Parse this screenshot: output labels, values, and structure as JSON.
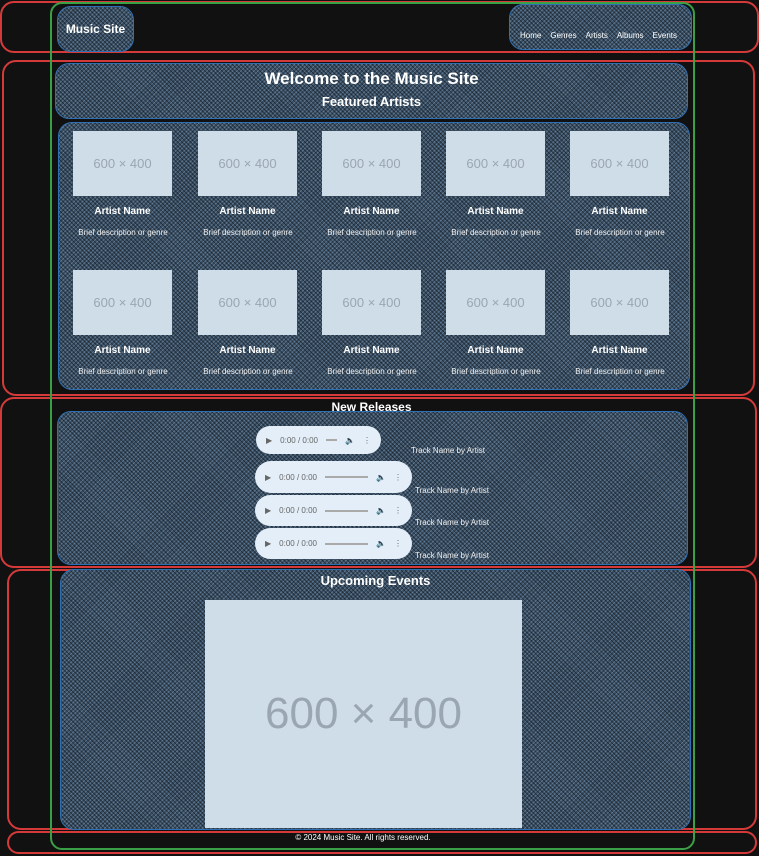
{
  "header": {
    "logo": "Music Site",
    "nav": [
      "Home",
      "Genres",
      "Artists",
      "Albums",
      "Events"
    ]
  },
  "hero": {
    "title": "Welcome to the Music Site",
    "featured_title": "Featured Artists"
  },
  "artists": [
    {
      "image": "600 × 400",
      "name": "Artist Name",
      "desc": "Brief description or genre"
    },
    {
      "image": "600 × 400",
      "name": "Artist Name",
      "desc": "Brief description or genre"
    },
    {
      "image": "600 × 400",
      "name": "Artist Name",
      "desc": "Brief description or genre"
    },
    {
      "image": "600 × 400",
      "name": "Artist Name",
      "desc": "Brief description or genre"
    },
    {
      "image": "600 × 400",
      "name": "Artist Name",
      "desc": "Brief description or genre"
    },
    {
      "image": "600 × 400",
      "name": "Artist Name",
      "desc": "Brief description or genre"
    },
    {
      "image": "600 × 400",
      "name": "Artist Name",
      "desc": "Brief description or genre"
    },
    {
      "image": "600 × 400",
      "name": "Artist Name",
      "desc": "Brief description or genre"
    },
    {
      "image": "600 × 400",
      "name": "Artist Name",
      "desc": "Brief description or genre"
    },
    {
      "image": "600 × 400",
      "name": "Artist Name",
      "desc": "Brief description or genre"
    }
  ],
  "releases": {
    "title": "New Releases",
    "tracks": [
      {
        "time": "0:00 / 0:00",
        "label": "Track Name by Artist"
      },
      {
        "time": "0:00 / 0:00",
        "label": "Track Name by Artist"
      },
      {
        "time": "0:00 / 0:00",
        "label": "Track Name by Artist"
      },
      {
        "time": "0:00 / 0:00",
        "label": "Track Name by Artist"
      }
    ]
  },
  "events": {
    "title": "Upcoming Events",
    "image": "600 × 400"
  },
  "footer": {
    "text": "© 2024 Music Site. All rights reserved."
  }
}
